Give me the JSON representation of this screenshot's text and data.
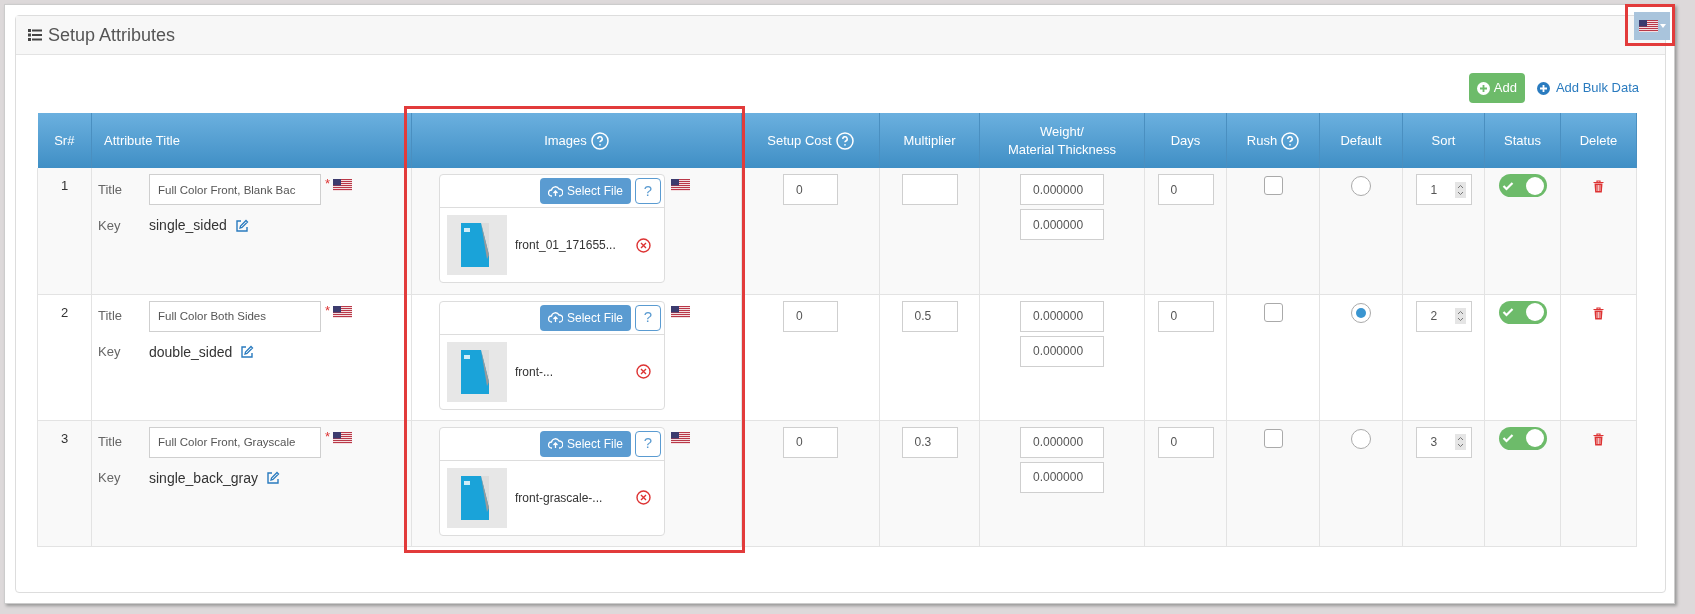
{
  "panel": {
    "title": "Setup Attributes"
  },
  "actions": {
    "add": "Add",
    "bulk": "Add Bulk Data"
  },
  "columns": [
    {
      "label": "Sr#",
      "help": false
    },
    {
      "label": "Attribute Title",
      "help": false
    },
    {
      "label": "Images",
      "help": true
    },
    {
      "label": "Setup Cost",
      "help": true
    },
    {
      "label": "Multiplier",
      "help": false
    },
    {
      "label": "Weight/\nMaterial Thickness",
      "help": false
    },
    {
      "label": "Days",
      "help": false
    },
    {
      "label": "Rush",
      "help": true
    },
    {
      "label": "Default",
      "help": false
    },
    {
      "label": "Sort",
      "help": false
    },
    {
      "label": "Status",
      "help": false
    },
    {
      "label": "Delete",
      "help": false
    }
  ],
  "rows": [
    {
      "sr": "1",
      "title_label": "Title",
      "title": "Full Color Front, Blank Bac",
      "required": "*",
      "key_label": "Key",
      "key": "single_sided",
      "select_file": "Select File",
      "help": "?",
      "file_name": "front_01_171655...",
      "setup_cost": "0",
      "weight": [
        "0.000000",
        "0.000000"
      ],
      "days": "0",
      "rush": false,
      "selected": false,
      "sort": "1",
      "status": true
    },
    {
      "sr": "2",
      "title_label": "Title",
      "title": "Full Color Both Sides",
      "required": "*",
      "key_label": "Key",
      "key": "double_sided",
      "select_file": "Select File",
      "help": "?",
      "file_name": "front-...",
      "setup_cost": "0",
      "multiplier": "0.5",
      "weight": [
        "0.000000",
        "0.000000"
      ],
      "days": "0",
      "rush": false,
      "selected": true,
      "sort": "2",
      "status": true
    },
    {
      "sr": "3",
      "title_label": "Title",
      "title": "Full Color Front, Grayscale",
      "required": "*",
      "key_label": "Key",
      "key": "single_back_gray",
      "select_file": "Select File",
      "help": "?",
      "file_name": "front-grascale-...",
      "setup_cost": "0",
      "multiplier": "0.3",
      "weight": [
        "0.000000",
        "0.000000"
      ],
      "days": "0",
      "rush": false,
      "selected": false,
      "sort": "3",
      "status": true
    }
  ]
}
